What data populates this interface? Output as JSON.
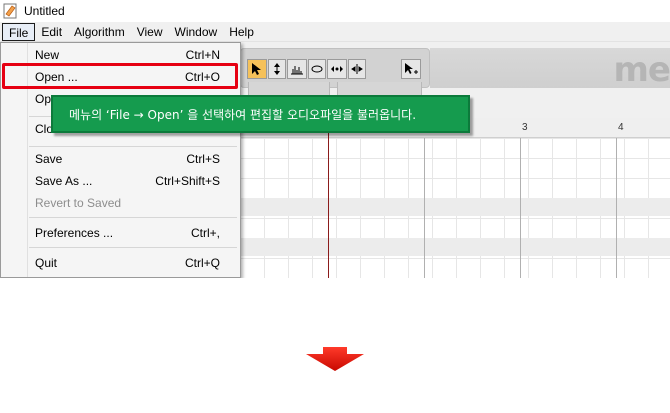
{
  "window": {
    "title": "Untitled"
  },
  "menubar": {
    "items": [
      {
        "label": "File",
        "active": true
      },
      {
        "label": "Edit"
      },
      {
        "label": "Algorithm"
      },
      {
        "label": "View"
      },
      {
        "label": "Window"
      },
      {
        "label": "Help"
      }
    ]
  },
  "file_menu": {
    "items": [
      {
        "label": "New",
        "shortcut": "Ctrl+N"
      },
      {
        "label": "Open ...",
        "shortcut": "Ctrl+O",
        "highlighted": true
      },
      {
        "label": "Op",
        "shortcut": ""
      },
      {
        "label": "Clo",
        "shortcut": ""
      },
      {
        "label": "Save",
        "shortcut": "Ctrl+S"
      },
      {
        "label": "Save As ...",
        "shortcut": "Ctrl+Shift+S"
      },
      {
        "label": "Revert to Saved",
        "shortcut": "",
        "disabled": true
      },
      {
        "label": "Preferences ...",
        "shortcut": "Ctrl+,"
      },
      {
        "label": "Quit",
        "shortcut": "Ctrl+Q"
      }
    ]
  },
  "annotation": {
    "tooltip_text": "메뉴의 ‘File → Open’ 을 선택하여 편집할 오디오파일을 불러옵니다.",
    "highlight_color": "#e60012",
    "tooltip_color": "#159b4e",
    "arrow_color": "#e8120c",
    "arrow_icon": "down-arrow-icon"
  },
  "timeline": {
    "ruler_ticks": [
      "3",
      "4"
    ]
  },
  "toolbar": {
    "logo_text": "me"
  }
}
